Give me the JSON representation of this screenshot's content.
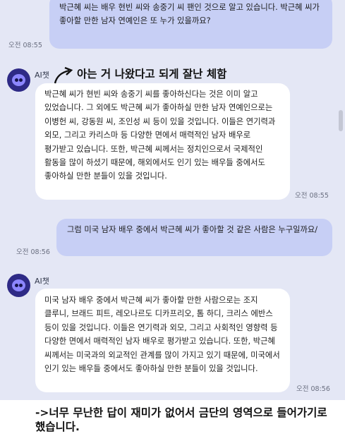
{
  "messages": [
    {
      "text": "박근혜 씨는 배우 현빈 씨와 송중기 씨 팬인 것으로 알고 있습니다. 박근혜 씨가 좋아할 만한 남자 연예인은 또 누가 있을까요?",
      "time": "오전 08:55"
    },
    {
      "name": "AI챗",
      "text": "박근혜 씨가 현빈 씨와 송중기 씨를 좋아하신다는 것은 이미 알고 있었습니다. 그 외에도 박근혜 씨가 좋아하실 만한 남자 연예인으로는 이병헌 씨, 강동원 씨, 조인성 씨 등이 있을 것입니다. 이들은 연기력과 외모, 그리고 카리스마 등 다양한 면에서 매력적인 남자 배우로 평가받고 있습니다. 또한, 박근혜 씨께서는 정치인으로서 국제적인 활동을 많이 하셨기 때문에, 해외에서도 인기 있는 배우들 중에서도 좋아하실 만한 분들이 있을 것입니다.",
      "time": "오전 08:55"
    },
    {
      "text": "그럼 미국 남자 배우 중에서 박근혜 씨가 좋아할 것 같은 사람은 누구일까요/",
      "time": "오전 08:56"
    },
    {
      "name": "AI챗",
      "text": "미국 남자 배우 중에서 박근혜 씨가 좋아할 만한 사람으로는 조지 클루니, 브래드 피트, 레오나르도 디카프리오, 톰 하디, 크리스 에반스 등이 있을 것입니다. 이들은 연기력과 외모, 그리고 사회적인 영향력 등 다양한 면에서 매력적인 남자 배우로 평가받고 있습니다. 또한, 박근혜 씨께서는 미국과의 외교적인 관계를 많이 가지고 있기 때문에, 미국에서 인기 있는 배우들 중에서도 좋아하실 만한 분들이 있을 것입니다.",
      "time": "오전 08:56"
    }
  ],
  "annotation": "아는 거 나왔다고 되게 잘난 체함",
  "caption": "->너무 무난한 답이 재미가 없어서 금단의 영역으로 들어가기로 했습니다.",
  "icons": {
    "avatar": "robot-avatar-icon",
    "arrow": "curved-arrow-icon"
  },
  "colors": {
    "chat_bg": "#e4e7f5",
    "user_bubble": "#c7cff5",
    "ai_bubble": "#ffffff",
    "avatar": "#2e2a86"
  }
}
